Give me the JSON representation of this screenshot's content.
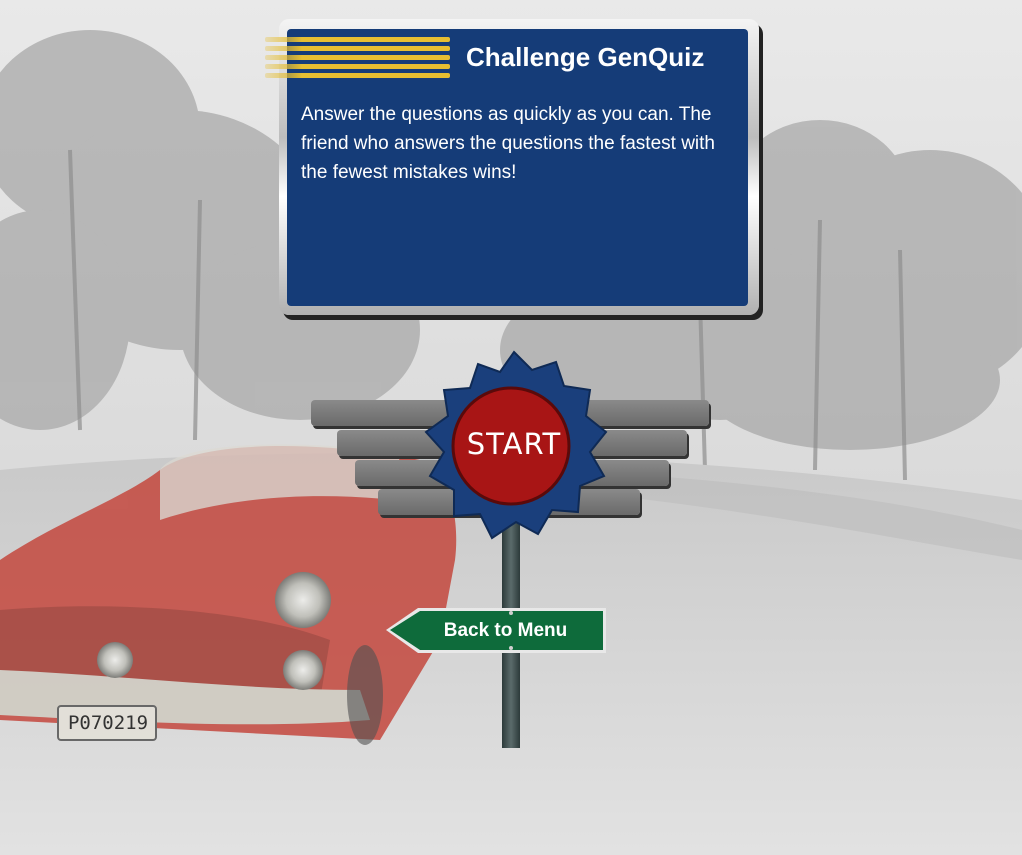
{
  "board": {
    "title": "Challenge GenQuiz",
    "description": "Answer the questions as quickly as you can. The friend who answers the questions the fastest with the fewest mistakes wins!"
  },
  "start_sign": {
    "label": "START"
  },
  "back_sign": {
    "label": "Back to Menu"
  },
  "background": {
    "car_plate": "P070219"
  },
  "colors": {
    "board_blue": "#153c78",
    "start_red": "#a81515",
    "badge_blue": "#1a3f7c",
    "back_green": "#0e6b3b",
    "stripe_gold": "#e6be32"
  }
}
